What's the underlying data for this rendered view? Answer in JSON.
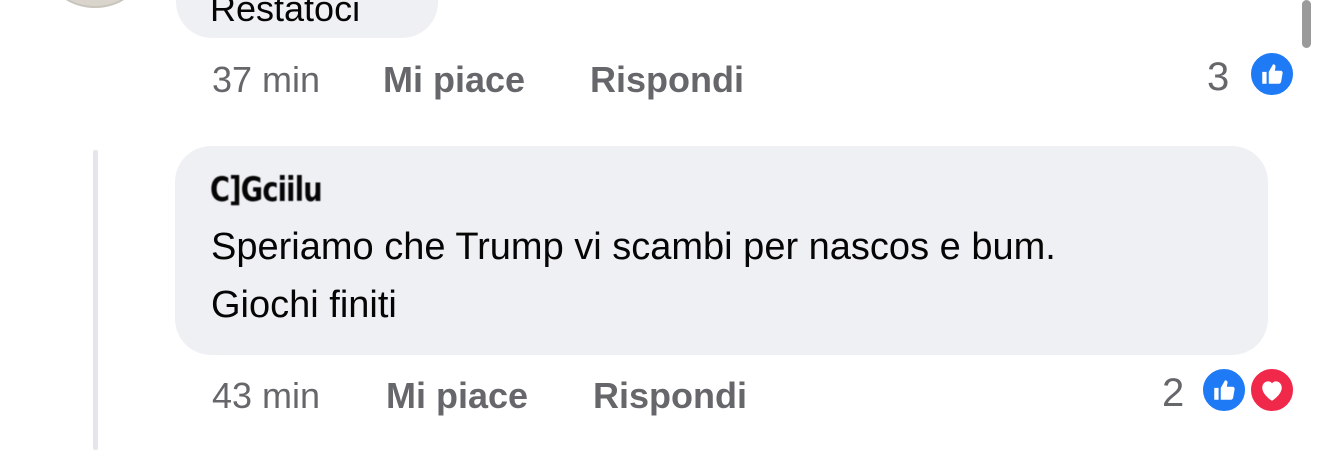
{
  "comment_top": {
    "cut_text": "Restatoci",
    "time": "37 min",
    "like_label": "Mi piace",
    "reply_label": "Rispondi",
    "reaction_count": "3",
    "reactions": [
      "like-icon"
    ]
  },
  "comment_main": {
    "author": "C]Gciilu",
    "text_line1": "Speriamo che Trump vi scambi per nascos e bum.",
    "text_line2": "Giochi finiti",
    "time": "43 min",
    "like_label": "Mi piace",
    "reply_label": "Rispondi",
    "reaction_count": "2",
    "reactions": [
      "like-icon",
      "love-icon"
    ]
  },
  "colors": {
    "bubble": "#eef0f3",
    "meta_text": "#65676b",
    "like_blue": "#1f7af6",
    "love_red": "#f0284a"
  }
}
